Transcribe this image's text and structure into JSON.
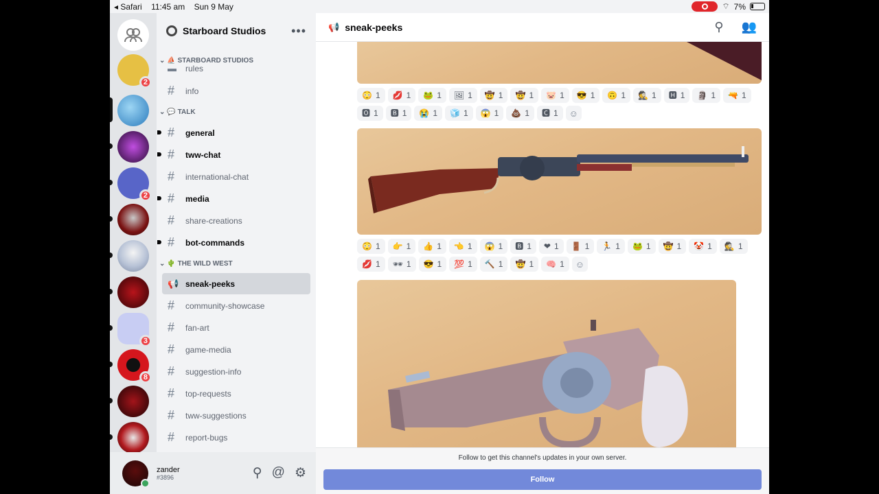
{
  "status_bar": {
    "back_app": "◂ Safari",
    "time": "11:45 am",
    "date": "Sun 9 May",
    "battery": "7%"
  },
  "guilds": [
    {
      "badge": ""
    },
    {
      "badge": "2"
    },
    {
      "badge": ""
    },
    {
      "badge": ""
    },
    {
      "badge": "2"
    },
    {
      "badge": ""
    },
    {
      "badge": ""
    },
    {
      "badge": ""
    },
    {
      "badge": "3"
    },
    {
      "badge": "8"
    },
    {
      "badge": ""
    },
    {
      "badge": ""
    }
  ],
  "server": {
    "name": "Starboard Studios",
    "menu": "•••"
  },
  "categories": {
    "starboard": "⛵ STARBOARD STUDIOS",
    "talk": "💬 TALK",
    "wildwest": "🌵 THE WILD WEST"
  },
  "channels": {
    "rules": "rules",
    "info": "info",
    "general": "general",
    "tww_chat": "tww-chat",
    "international_chat": "international-chat",
    "media": "media",
    "share_creations": "share-creations",
    "bot_commands": "bot-commands",
    "sneak_peeks": "sneak-peeks",
    "community_showcase": "community-showcase",
    "fan_art": "fan-art",
    "game_media": "game-media",
    "suggestion_info": "suggestion-info",
    "top_requests": "top-requests",
    "tww_suggestions": "tww-suggestions",
    "report_bugs": "report-bugs"
  },
  "user": {
    "name": "zander",
    "discriminator": "#3896"
  },
  "header": {
    "channel": "sneak-peeks"
  },
  "reactions_1": [
    {
      "e": "😳",
      "c": "1"
    },
    {
      "e": "💋",
      "c": "1"
    },
    {
      "e": "🐸",
      "c": "1"
    },
    {
      "e": "🖼",
      "c": "1"
    },
    {
      "e": "🤠",
      "c": "1"
    },
    {
      "e": "🤠",
      "c": "1"
    },
    {
      "e": "🐷",
      "c": "1"
    },
    {
      "e": "😎",
      "c": "1"
    },
    {
      "e": "🙃",
      "c": "1"
    },
    {
      "e": "🕵",
      "c": "1"
    },
    {
      "e": "🅷",
      "c": "1"
    },
    {
      "e": "🗿",
      "c": "1"
    },
    {
      "e": "🔫",
      "c": "1"
    },
    {
      "e": "🅾",
      "c": "1"
    },
    {
      "e": "🅱",
      "c": "1"
    },
    {
      "e": "😭",
      "c": "1"
    },
    {
      "e": "🧊",
      "c": "1"
    },
    {
      "e": "😱",
      "c": "1"
    },
    {
      "e": "💩",
      "c": "1"
    },
    {
      "e": "🅲",
      "c": "1"
    }
  ],
  "reactions_2": [
    {
      "e": "😳",
      "c": "1"
    },
    {
      "e": "👉",
      "c": "1"
    },
    {
      "e": "👍",
      "c": "1"
    },
    {
      "e": "👈",
      "c": "1"
    },
    {
      "e": "😱",
      "c": "1"
    },
    {
      "e": "🅱",
      "c": "1"
    },
    {
      "e": "❤",
      "c": "1"
    },
    {
      "e": "🚪",
      "c": "1"
    },
    {
      "e": "🏃",
      "c": "1"
    },
    {
      "e": "🐸",
      "c": "1"
    },
    {
      "e": "🤠",
      "c": "1"
    },
    {
      "e": "🤡",
      "c": "1"
    },
    {
      "e": "🕵",
      "c": "1"
    },
    {
      "e": "💋",
      "c": "1"
    },
    {
      "e": "🕶",
      "c": "1"
    },
    {
      "e": "😎",
      "c": "1"
    },
    {
      "e": "💯",
      "c": "1"
    },
    {
      "e": "🔨",
      "c": "1"
    },
    {
      "e": "🤠",
      "c": "1"
    },
    {
      "e": "🧠",
      "c": "1"
    }
  ],
  "follow": {
    "message": "Follow to get this channel's updates in your own server.",
    "button": "Follow"
  }
}
